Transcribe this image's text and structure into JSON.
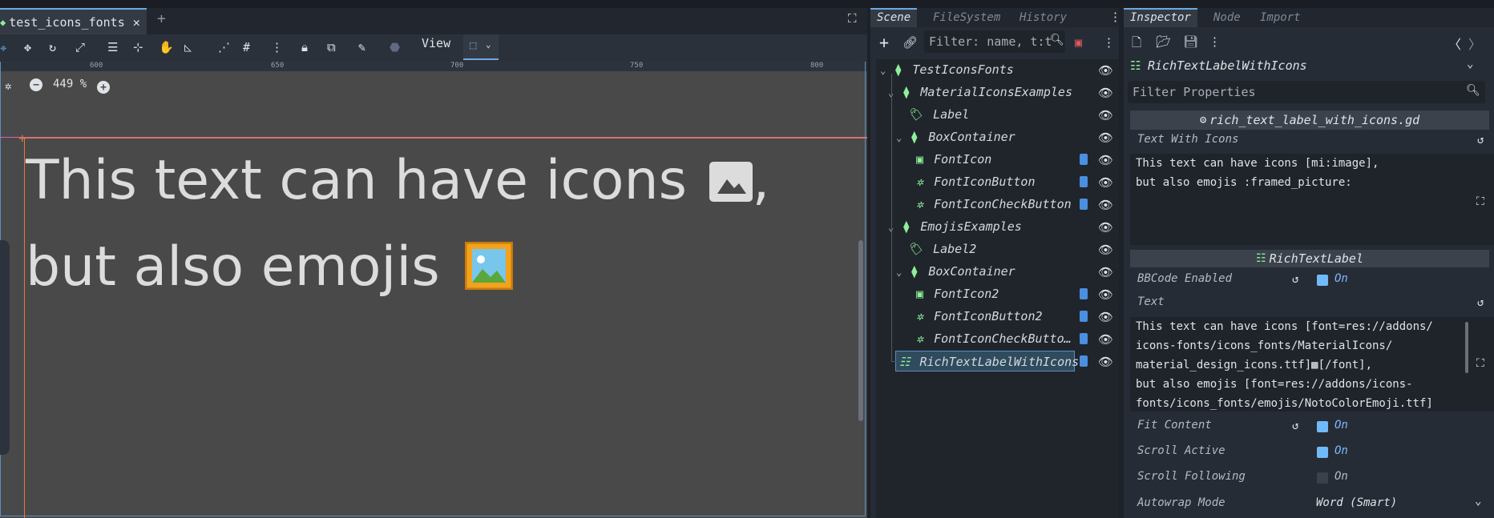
{
  "editor": {
    "scene_tab_label": "test_icons_fonts",
    "toolbar_view_label": "View",
    "zoom_label": "449 %",
    "ruler_ticks": [
      "600",
      "650",
      "700",
      "750",
      "800"
    ],
    "canvas_line1": "This text can have icons",
    "canvas_line1_suffix": ",",
    "canvas_line2": "but also emojis",
    "colors": {
      "selection": "#e07a3a",
      "accent": "#6ea9e0",
      "canvas": "#494949"
    }
  },
  "scene_dock": {
    "tabs": [
      "Scene",
      "FileSystem",
      "History"
    ],
    "filter_placeholder": "Filter: name, t:t",
    "nodes": [
      {
        "label": "TestIconsFonts",
        "icon": "control-icon",
        "script": false
      },
      {
        "label": "MaterialIconsExamples",
        "icon": "control-icon",
        "script": false
      },
      {
        "label": "Label",
        "icon": "label-icon",
        "script": false
      },
      {
        "label": "BoxContainer",
        "icon": "control-icon",
        "script": false
      },
      {
        "label": "FontIcon",
        "icon": "texture-rect-icon",
        "script": true
      },
      {
        "label": "FontIconButton",
        "icon": "button-icon",
        "script": true
      },
      {
        "label": "FontIconCheckButton",
        "icon": "button-icon",
        "script": true
      },
      {
        "label": "EmojisExamples",
        "icon": "control-icon",
        "script": false
      },
      {
        "label": "Label2",
        "icon": "label-icon",
        "script": false
      },
      {
        "label": "BoxContainer",
        "icon": "control-icon",
        "script": false
      },
      {
        "label": "FontIcon2",
        "icon": "texture-rect-icon",
        "script": true
      },
      {
        "label": "FontIconButton2",
        "icon": "button-icon",
        "script": true
      },
      {
        "label": "FontIconCheckButto…",
        "icon": "button-icon",
        "script": true
      },
      {
        "label": "RichTextLabelWithIcons",
        "icon": "rich-text-icon",
        "script": true
      }
    ]
  },
  "inspector": {
    "tabs": [
      "Inspector",
      "Node",
      "Import"
    ],
    "object_name": "RichTextLabelWithIcons",
    "filter_placeholder": "Filter Properties",
    "script_section": "rich_text_label_with_icons.gd",
    "text_with_icons_label": "Text With Icons",
    "text_with_icons_value": [
      "This text can have icons [mi:image],",
      "but also emojis :framed_picture:"
    ],
    "class_section": "RichTextLabel",
    "bbcode_label": "BBCode Enabled",
    "bbcode_value": "On",
    "text_label": "Text",
    "text_value": [
      "This text can have icons [font=res://addons/",
      "icons-fonts/icons_fonts/MaterialIcons/",
      "material_design_icons.ttf]",
      "[/font],",
      "but also emojis [font=res://addons/icons-",
      "fonts/icons_fonts/emojis/NotoColorEmoji.ttf]"
    ],
    "fit_content_label": "Fit Content",
    "fit_content_value": "On",
    "scroll_active_label": "Scroll Active",
    "scroll_active_value": "On",
    "scroll_following_label": "Scroll Following",
    "scroll_following_value": "On",
    "autowrap_label": "Autowrap Mode",
    "autowrap_value": "Word (Smart)"
  }
}
